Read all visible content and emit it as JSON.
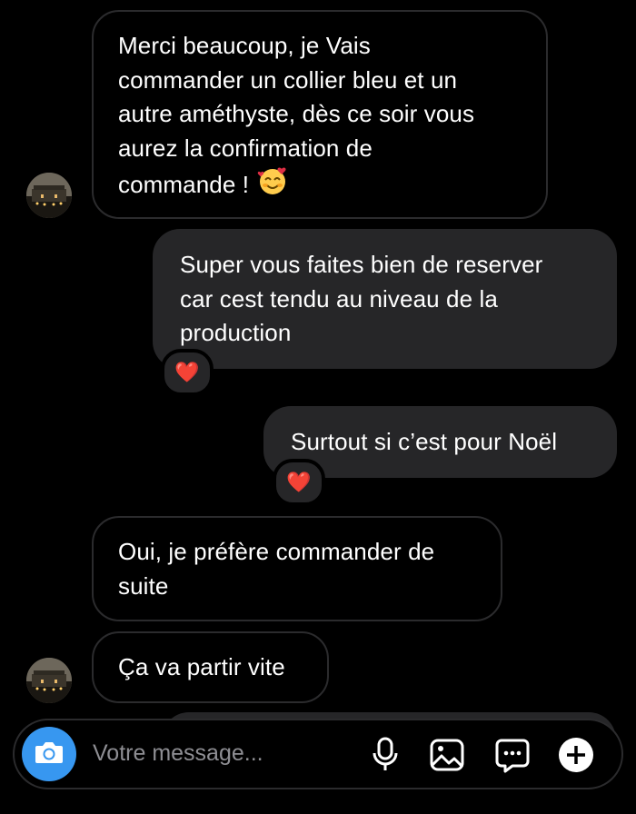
{
  "messages": [
    {
      "side": "incoming",
      "lines": [
        "Merci beaucoup, je Vais",
        "commander un collier bleu et un",
        "autre améthyste, dès ce soir vous",
        "aurez la confirmation de",
        "commande !"
      ],
      "emoji": "smiling-face-with-hearts"
    },
    {
      "side": "outgoing",
      "lines": [
        "Super vous faites bien de reserver",
        "car cest tendu au niveau de la",
        "production"
      ],
      "reaction": "❤️"
    },
    {
      "side": "outgoing",
      "lines": [
        "Surtout si c’est pour Noël"
      ],
      "reaction": "❤️"
    },
    {
      "side": "incoming",
      "lines": [
        "Oui, je préfère commander de",
        "suite"
      ]
    },
    {
      "side": "incoming",
      "lines": [
        "Ça va partir vite"
      ]
    }
  ],
  "composer": {
    "placeholder": "Votre message...",
    "icons": [
      "camera-icon",
      "microphone-icon",
      "image-icon",
      "sticker-icon",
      "plus-icon"
    ]
  },
  "colors": {
    "background": "#000000",
    "outgoing_bubble": "#262628",
    "incoming_border": "#2b2b2d",
    "camera_button": "#3797f0",
    "placeholder_text": "#8e8e93",
    "reaction_heart": "#ff2d3b"
  }
}
